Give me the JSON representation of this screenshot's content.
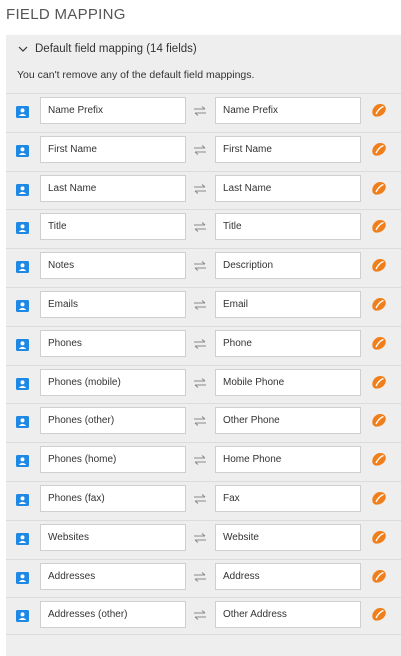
{
  "section_title": "FIELD MAPPING",
  "panel": {
    "header": "Default field mapping (14 fields)",
    "note": "You can't remove any of the default field mappings."
  },
  "icons": {
    "collapse": "chevron-down-icon",
    "source": "contact-card-icon",
    "mapping": "swap-arrows-icon",
    "target": "orange-app-icon"
  },
  "colors": {
    "contact_icon": "#1e88e5",
    "target_icon": "#f07f1b",
    "panel_bg": "#eeeeee"
  },
  "mappings": [
    {
      "source": "Name Prefix",
      "target": "Name Prefix"
    },
    {
      "source": "First Name",
      "target": "First Name"
    },
    {
      "source": "Last Name",
      "target": "Last Name"
    },
    {
      "source": "Title",
      "target": "Title"
    },
    {
      "source": "Notes",
      "target": "Description"
    },
    {
      "source": "Emails",
      "target": "Email"
    },
    {
      "source": "Phones",
      "target": "Phone"
    },
    {
      "source": "Phones (mobile)",
      "target": "Mobile Phone"
    },
    {
      "source": "Phones (other)",
      "target": "Other Phone"
    },
    {
      "source": "Phones (home)",
      "target": "Home Phone"
    },
    {
      "source": "Phones (fax)",
      "target": "Fax"
    },
    {
      "source": "Websites",
      "target": "Website"
    },
    {
      "source": "Addresses",
      "target": "Address"
    },
    {
      "source": "Addresses (other)",
      "target": "Other Address"
    }
  ]
}
